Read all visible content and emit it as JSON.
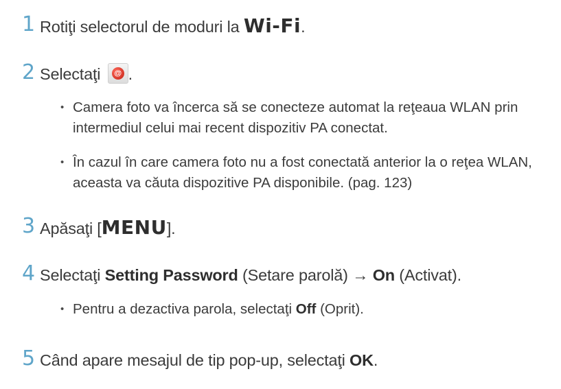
{
  "steps": [
    {
      "number": "1",
      "text_before": "Rotiţi selectorul de moduri la ",
      "mode_label": "Wi-Fi",
      "text_after": "."
    },
    {
      "number": "2",
      "text_before": "Selectaţi ",
      "icon": "email-icon",
      "icon_glyph": "@",
      "text_after": ".",
      "bullets": [
        "Camera foto va încerca să se conecteze automat la reţeaua WLAN prin intermediul celui mai recent dispozitiv PA conectat.",
        "În cazul în care camera foto nu a fost conectată anterior la o reţea WLAN, aceasta va căuta dispozitive PA disponibile. (pag. 123)"
      ]
    },
    {
      "number": "3",
      "text_before": "Apăsaţi [",
      "button_label": "MENU",
      "text_after": "]."
    },
    {
      "number": "4",
      "text_before": "Selectaţi ",
      "bold1": "Setting Password",
      "mid1": " (Setare parolă) → ",
      "bold2": "On",
      "text_after": " (Activat).",
      "bullets": [
        {
          "before": "Pentru a dezactiva parola, selectaţi ",
          "bold": "Off",
          "after": " (Oprit)."
        }
      ]
    },
    {
      "number": "5",
      "text_before": "Când apare mesajul de tip pop-up, selectaţi ",
      "bold": "OK",
      "text_after": "."
    }
  ],
  "colors": {
    "step_number": "#5fa5c9",
    "text": "#3b3b3b",
    "icon_red": "#c31f12"
  }
}
